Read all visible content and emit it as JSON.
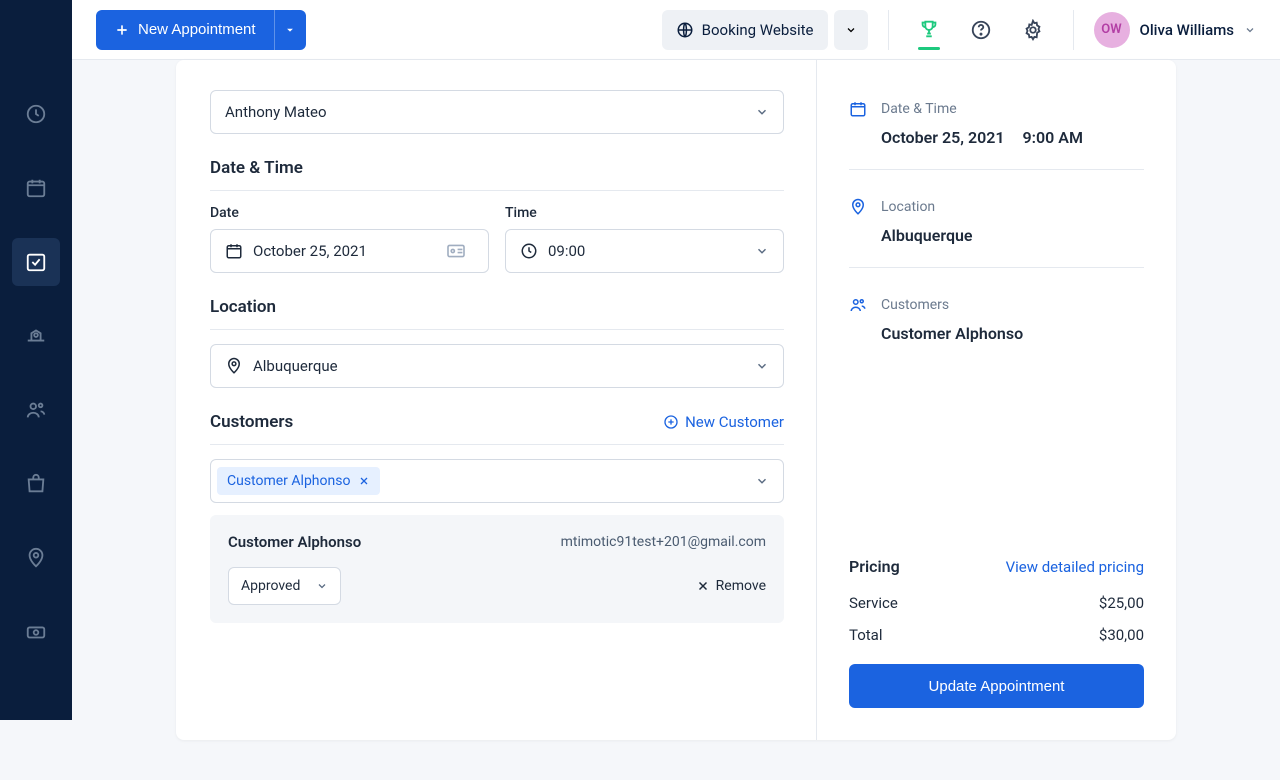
{
  "topbar": {
    "new_appointment_label": "New Appointment",
    "booking_website_label": "Booking Website",
    "user_initials": "OW",
    "user_name": "Oliva Williams"
  },
  "form": {
    "employee_name": "Anthony Mateo",
    "datetime_heading": "Date & Time",
    "date_label": "Date",
    "date_value": "October 25, 2021",
    "time_label": "Time",
    "time_value": "09:00",
    "location_heading": "Location",
    "location_value": "Albuquerque",
    "customers_heading": "Customers",
    "new_customer_label": "New Customer",
    "customer_chip": "Customer Alphonso",
    "customer_name": "Customer Alphonso",
    "customer_email": "mtimotic91test+201@gmail.com",
    "status_value": "Approved",
    "remove_label": "Remove"
  },
  "summary": {
    "datetime_label": "Date & Time",
    "datetime_date": "October 25, 2021",
    "datetime_time": "9:00 AM",
    "location_label": "Location",
    "location_value": "Albuquerque",
    "customers_label": "Customers",
    "customer_name": "Customer Alphonso",
    "pricing_title": "Pricing",
    "view_pricing": "View detailed pricing",
    "service_label": "Service",
    "service_price": "$25,00",
    "total_label": "Total",
    "total_price": "$30,00",
    "update_label": "Update Appointment"
  }
}
